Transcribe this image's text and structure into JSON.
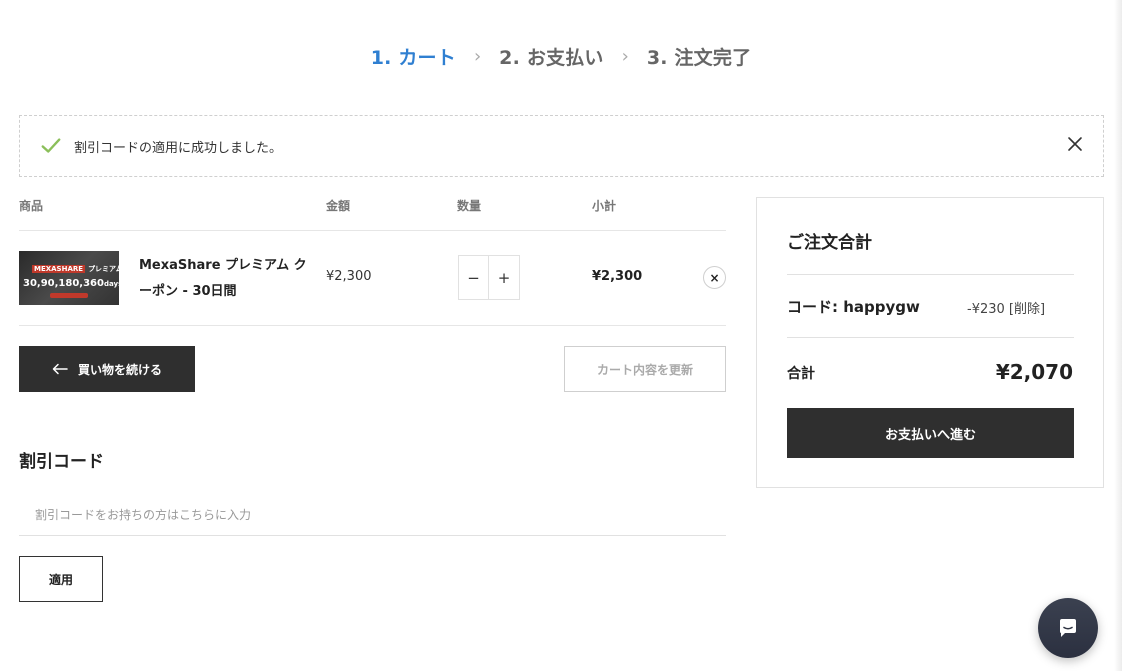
{
  "steps": [
    {
      "label": "1. カート",
      "active": true
    },
    {
      "label": "2. お支払い",
      "active": false
    },
    {
      "label": "3. 注文完了",
      "active": false
    }
  ],
  "step_separator": "›",
  "notice": {
    "message": "割引コードの適用に成功しました。",
    "icon": "check-icon",
    "close_icon": "close-icon"
  },
  "cart": {
    "headers": {
      "product": "商品",
      "price": "金額",
      "quantity": "数量",
      "subtotal": "小計"
    },
    "items": [
      {
        "thumbnail": {
          "badge": "MEXASHARE",
          "caption": "プレミアム会員",
          "durations": "30,90,180,360",
          "durations_unit": "days"
        },
        "name": "MexaShare プレミアム クーポン - 30日間",
        "price": "¥2,300",
        "quantity_minus": "−",
        "quantity_plus": "+",
        "subtotal": "¥2,300",
        "remove": "×"
      }
    ],
    "continue_label": "買い物を続ける",
    "update_label": "カート内容を更新"
  },
  "coupon": {
    "title": "割引コード",
    "placeholder": "割引コードをお持ちの方はこちらに入力",
    "apply_label": "適用"
  },
  "summary": {
    "title": "ご注文合計",
    "code_label": "コード: happygw",
    "code_discount": "-¥230",
    "code_remove": "[削除]",
    "total_label": "合計",
    "total_value": "¥2,070",
    "checkout_label": "お支払いへ進む"
  },
  "colors": {
    "accent": "#2f7fd1",
    "dark_button": "#2f2f2f",
    "success_check": "#8bbf5a"
  }
}
